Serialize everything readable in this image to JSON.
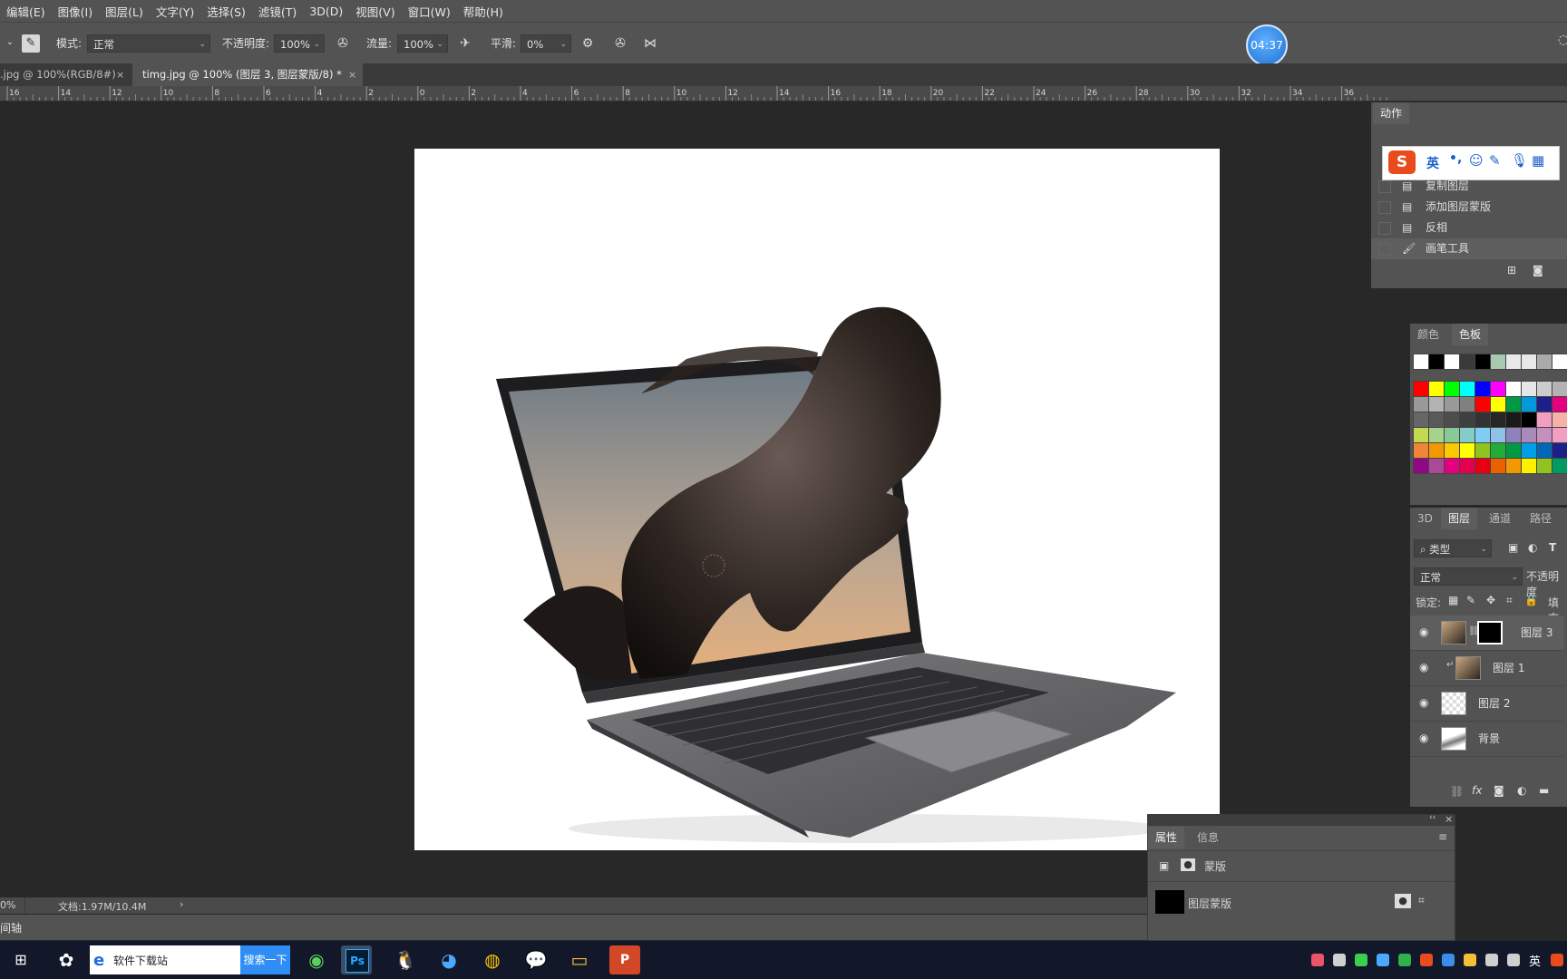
{
  "menu": [
    "编辑(E)",
    "图像(I)",
    "图层(L)",
    "文字(Y)",
    "选择(S)",
    "滤镜(T)",
    "3D(D)",
    "视图(V)",
    "窗口(W)",
    "帮助(H)"
  ],
  "options": {
    "mode_label": "模式:",
    "mode_value": "正常",
    "opacity_label": "不透明度:",
    "opacity_value": "100%",
    "flow_label": "流量:",
    "flow_value": "100%",
    "smooth_label": "平滑:",
    "smooth_value": "0%"
  },
  "timer": "04:37",
  "tabs": [
    {
      "label": ".jpg @ 100%(RGB/8#)",
      "close": "×",
      "active": false
    },
    {
      "label": "timg.jpg @ 100% (图层 3, 图层蒙版/8) *",
      "close": "×",
      "active": true
    }
  ],
  "ruler": [
    "16",
    "14",
    "12",
    "10",
    "8",
    "6",
    "4",
    "2",
    "0",
    "2",
    "4",
    "6",
    "8",
    "10",
    "12",
    "14",
    "16",
    "18",
    "20",
    "22",
    "24",
    "26",
    "28",
    "30",
    "32",
    "34",
    "36"
  ],
  "status": {
    "zoom": "0%",
    "doc": "文档:1.97M/10.4M",
    "arrow": "›"
  },
  "timeline": {
    "label": "间轴"
  },
  "actions_panel": {
    "title": "动作",
    "ime": {
      "logo": "S",
      "lang": "英",
      "punct": "•,"
    },
    "items": [
      "复制图层",
      "添加图层蒙版",
      "反相",
      "画笔工具"
    ]
  },
  "swatches_panel": {
    "tabs": [
      "颜色",
      "色板"
    ],
    "active_tab": 1,
    "row0": [
      "#ffffff",
      "#000000",
      "#ffffff",
      "#3a3a3a",
      "#000000",
      "#a8c8b0",
      "#e8e8e8",
      "#e8e8e8",
      "#aaaaaa",
      "#ffffff"
    ],
    "rows": [
      [
        "#ff0000",
        "#ffff00",
        "#00ff00",
        "#00ffff",
        "#0000ff",
        "#ff00ff",
        "#ffffff",
        "#e6e6e6",
        "#cccccc",
        "#b3b3b3"
      ],
      [
        "#999999",
        "#b3b3b3",
        "#999999",
        "#808080",
        "#ff0000",
        "#ffff00",
        "#009944",
        "#0099dd",
        "#1d2088",
        "#e4007f"
      ],
      [
        "#666666",
        "#595959",
        "#4d4d4d",
        "#404040",
        "#333333",
        "#262626",
        "#1a1a1a",
        "#000000",
        "#f19ec2",
        "#f5b1aa"
      ],
      [
        "#c3d94e",
        "#a7d28d",
        "#89c997",
        "#84ccc9",
        "#7ecef4",
        "#8fc2e6",
        "#8f82bc",
        "#aa89bd",
        "#c490bf",
        "#f19ec2"
      ],
      [
        "#f08437",
        "#f39800",
        "#fcc800",
        "#ffff00",
        "#8fc31f",
        "#22ac38",
        "#009944",
        "#00a0e9",
        "#0068b7",
        "#1d2088"
      ],
      [
        "#920783",
        "#a84a96",
        "#e4007f",
        "#e5004f",
        "#e60012",
        "#eb6100",
        "#f39800",
        "#fff100",
        "#8fc31f",
        "#009b63"
      ]
    ]
  },
  "layers_panel": {
    "tabs": [
      "3D",
      "图层",
      "通道",
      "路径"
    ],
    "active_tab": 1,
    "filter": "类型",
    "blend": "正常",
    "opacity_label": "不透明度",
    "lock_label": "锁定:",
    "fill_label": "填充",
    "layers": [
      {
        "name": "图层 3",
        "mask": true,
        "clip": false
      },
      {
        "name": "图层 1",
        "mask": false,
        "clip": true
      },
      {
        "name": "图层 2",
        "mask": false,
        "clip": false
      },
      {
        "name": "背景",
        "mask": false,
        "clip": false
      }
    ],
    "footer_fx": "fx"
  },
  "properties_panel": {
    "tabs": [
      "属性",
      "信息"
    ],
    "active_tab": 0,
    "section": "蒙版",
    "mask_label": "图层蒙版",
    "collapse": "‹‹",
    "close": "×"
  },
  "taskbar": {
    "search_text": "软件下载站",
    "search_button": "搜索一下",
    "ps_label": "Ps",
    "tray_lang": "英"
  },
  "colors": {
    "ps_bg": "#535353",
    "canvas_bg": "#282828",
    "accent": "#1f6fd1"
  }
}
